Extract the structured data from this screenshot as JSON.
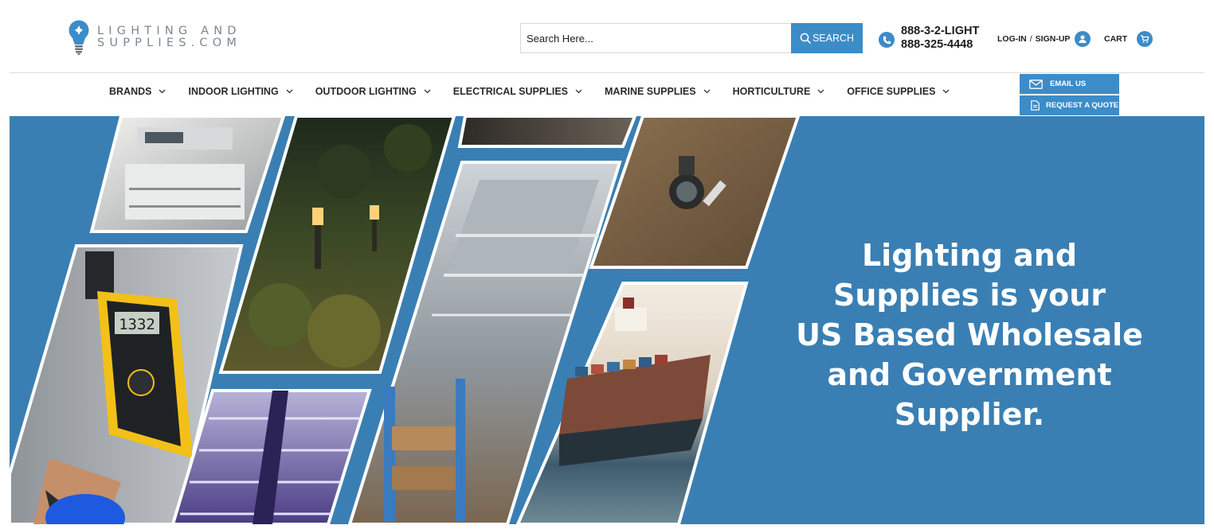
{
  "brand": {
    "logo_line1": "LIGHTING AND",
    "logo_line2": "SUPPLIES.COM",
    "icon": "lightbulb-logo-icon"
  },
  "search": {
    "placeholder": "Search Here...",
    "button_label": "SEARCH",
    "icon": "search-icon"
  },
  "contact": {
    "phone_vanity": "888-3-2-LIGHT",
    "phone_number": "888-325-4448",
    "icon": "phone-icon"
  },
  "account": {
    "login_label": "LOG-IN",
    "separator": "/",
    "signup_label": "SIGN-UP",
    "icon": "user-icon"
  },
  "cart": {
    "label": "CART",
    "icon": "cart-icon"
  },
  "nav": {
    "items": [
      {
        "label": "BRANDS"
      },
      {
        "label": "INDOOR LIGHTING"
      },
      {
        "label": "OUTDOOR LIGHTING"
      },
      {
        "label": "ELECTRICAL SUPPLIES"
      },
      {
        "label": "MARINE SUPPLIES"
      },
      {
        "label": "HORTICULTURE"
      },
      {
        "label": "OFFICE SUPPLIES"
      }
    ]
  },
  "quick_actions": {
    "email_label": "EMAIL US",
    "quote_label": "REQUEST A QUOTE"
  },
  "hero": {
    "headline_lines": [
      "Lighting and",
      "Supplies is your",
      "US Based Wholesale",
      "and Government",
      "Supplier."
    ],
    "multimeter_reading": "1332"
  },
  "colors": {
    "accent": "#3c8cc8",
    "hero_background": "#3a7fb3",
    "text_dark": "#222222",
    "logo_grey": "#7c8790"
  }
}
